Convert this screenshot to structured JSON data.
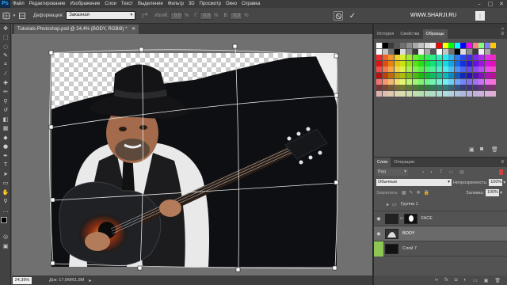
{
  "app": {
    "logo": "Ps"
  },
  "menu": [
    "Файл",
    "Редактирование",
    "Изображение",
    "Слои",
    "Текст",
    "Выделение",
    "Фильтр",
    "3D",
    "Просмотр",
    "Окно",
    "Справка"
  ],
  "options": {
    "warp_label": "Деформация:",
    "warp_value": "Заказная",
    "bend_label": "Изгиб:",
    "bend_value": "0,0",
    "h_label": "Г:",
    "h_value": "0,0",
    "v_label": "В:",
    "v_value": "0,0"
  },
  "site": "WWW.SHARJI.RU",
  "document": {
    "tab": "Tutorials-Photoshop.psd @ 24,4% (BODY, RGB/8) *"
  },
  "status": {
    "zoom": "24,39%",
    "doc": "Док: 17,6M/61,8M"
  },
  "panels": {
    "top_tabs": [
      "История",
      "Свойства",
      "Образцы"
    ],
    "layer_tabs": [
      "Слои",
      "Операции"
    ],
    "kind_label": "Вид",
    "blend_mode": "Обычные",
    "opacity_label": "Непрозрачность:",
    "opacity_value": "100%",
    "lock_label": "Закрепить:",
    "fill_label": "Заливка:",
    "fill_value": "100%",
    "layers": [
      "Группа 1",
      "FACE",
      "BODY",
      "Слой 7"
    ]
  },
  "colors": {
    "accent_green": "#8dc653",
    "selected_row": "#6a6a6a"
  }
}
